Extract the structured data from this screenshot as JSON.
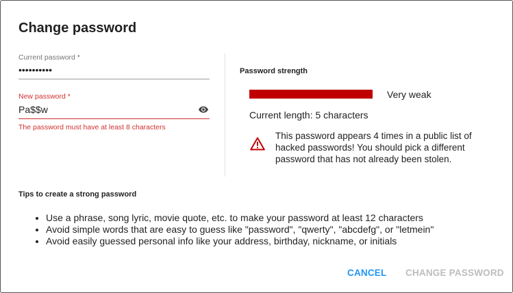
{
  "dialog": {
    "title": "Change password"
  },
  "current_password": {
    "label": "Current password *",
    "value": "••••••••••"
  },
  "new_password": {
    "label": "New password *",
    "value": "Pa$$w",
    "error": "The password must have at least 8 characters",
    "visibility_icon": "eye-icon"
  },
  "strength": {
    "heading": "Password strength",
    "level_label": "Very weak",
    "level_fraction": 1.0,
    "bar_color": "#c00000",
    "current_length": "Current length: 5 characters",
    "warning_icon": "warning-triangle-icon",
    "warning_color": "#c00000",
    "warning_text": "This password appears 4 times in a public list of hacked passwords! You should pick a different password that has not already been stolen."
  },
  "tips": {
    "heading": "Tips to create a strong password",
    "items": [
      "Use a phrase, song lyric, movie quote, etc. to make your password at least 12 characters",
      "Avoid simple words that are easy to guess like \"password\", \"qwerty\", \"abcdefg\", or \"letmein\"",
      "Avoid easily guessed personal info like your address, birthday, nickname, or initials"
    ]
  },
  "actions": {
    "cancel_label": "CANCEL",
    "change_label": "CHANGE PASSWORD"
  },
  "colors": {
    "accent": "#2196f3",
    "error": "#d32f2f",
    "disabled": "#bdbdbd"
  }
}
